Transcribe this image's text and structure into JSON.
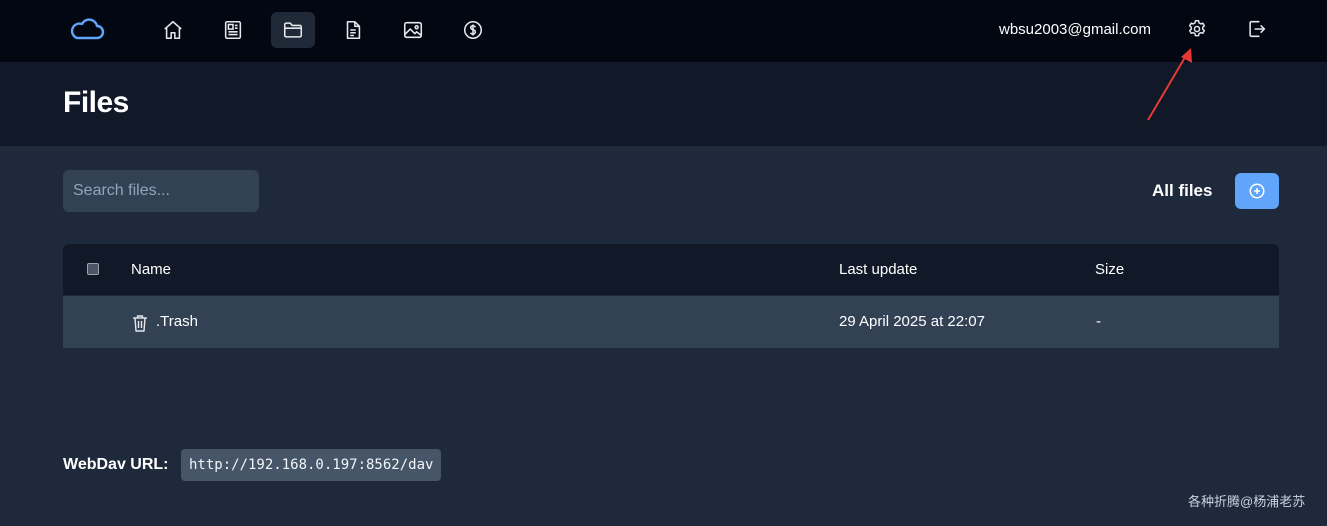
{
  "topbar": {
    "nav_items": [
      {
        "name": "home",
        "icon": "home-icon"
      },
      {
        "name": "notes",
        "icon": "newspaper-icon"
      },
      {
        "name": "files",
        "icon": "folder-icon",
        "active": true
      },
      {
        "name": "documents",
        "icon": "document-icon"
      },
      {
        "name": "photos",
        "icon": "image-icon"
      },
      {
        "name": "finance",
        "icon": "dollar-icon"
      }
    ],
    "user_email": "wbsu2003@gmail.com",
    "settings_icon": "gear-icon",
    "logout_icon": "logout-icon"
  },
  "page": {
    "title": "Files"
  },
  "toolbar": {
    "search_placeholder": "Search files...",
    "filter_label": "All files",
    "add_icon": "plus-circle-icon"
  },
  "table": {
    "columns": [
      "Name",
      "Last update",
      "Size"
    ],
    "rows": [
      {
        "name": ".Trash",
        "icon": "trash-icon",
        "last_update": "29 April 2025 at 22:07",
        "size": "-"
      }
    ]
  },
  "webdav": {
    "label": "WebDav URL:",
    "url": "http://192.168.0.197:8562/dav"
  },
  "watermark": "各种折腾@杨浦老苏",
  "colors": {
    "accent": "#60a5fa",
    "topbar": "#030712",
    "header": "#111827",
    "body": "#1e293b",
    "annotation_arrow": "#e53935"
  }
}
